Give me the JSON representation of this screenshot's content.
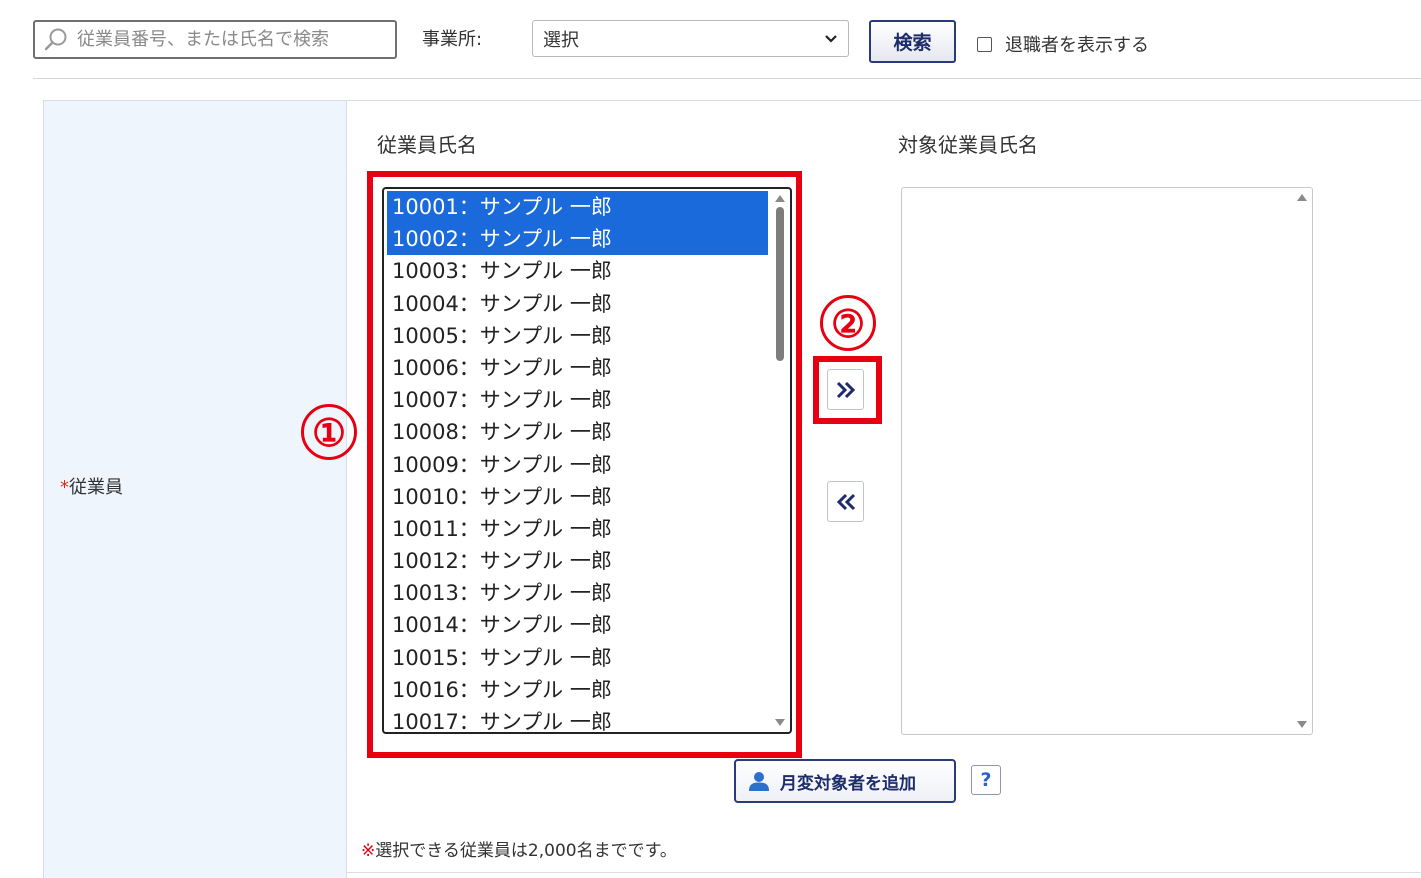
{
  "search": {
    "placeholder": "従業員番号、または氏名で検索",
    "value": ""
  },
  "office": {
    "label": "事業所:",
    "selected": "選択"
  },
  "search_button": {
    "label": "検索"
  },
  "show_retired": {
    "label": "退職者を表示する",
    "checked": false
  },
  "employee_field": {
    "required_mark": "*",
    "label": "従業員"
  },
  "source_list": {
    "heading": "従業員氏名",
    "options": [
      {
        "label": "10001：サンプル 一郎",
        "selected": true
      },
      {
        "label": "10002：サンプル 一郎",
        "selected": true
      },
      {
        "label": "10003：サンプル 一郎",
        "selected": false
      },
      {
        "label": "10004：サンプル 一郎",
        "selected": false
      },
      {
        "label": "10005：サンプル 一郎",
        "selected": false
      },
      {
        "label": "10006：サンプル 一郎",
        "selected": false
      },
      {
        "label": "10007：サンプル 一郎",
        "selected": false
      },
      {
        "label": "10008：サンプル 一郎",
        "selected": false
      },
      {
        "label": "10009：サンプル 一郎",
        "selected": false
      },
      {
        "label": "10010：サンプル 一郎",
        "selected": false
      },
      {
        "label": "10011：サンプル 一郎",
        "selected": false
      },
      {
        "label": "10012：サンプル 一郎",
        "selected": false
      },
      {
        "label": "10013：サンプル 一郎",
        "selected": false
      },
      {
        "label": "10014：サンプル 一郎",
        "selected": false
      },
      {
        "label": "10015：サンプル 一郎",
        "selected": false
      },
      {
        "label": "10016：サンプル 一郎",
        "selected": false
      },
      {
        "label": "10017：サンプル 一郎",
        "selected": false
      }
    ]
  },
  "target_list": {
    "heading": "対象従業員氏名",
    "options": []
  },
  "annotations": {
    "step1": "①",
    "step2": "②",
    "highlight_color": "#e60012"
  },
  "move_buttons": {
    "add_icon": "double-chevron-right-icon",
    "remove_icon": "double-chevron-left-icon"
  },
  "add_target_button": {
    "label": "月変対象者を追加",
    "icon": "person-icon"
  },
  "help_button": {
    "label": "?"
  },
  "note": {
    "mark": "※",
    "text": "選択できる従業員は2,000名までです。"
  },
  "colors": {
    "selected_row": "#1a6adb",
    "label_cell_bg": "#eef5fd",
    "button_border": "#2a3a7a"
  }
}
